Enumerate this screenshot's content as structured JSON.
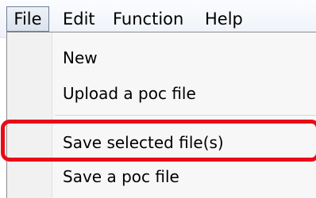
{
  "menubar": {
    "items": [
      {
        "label": "File",
        "active": true
      },
      {
        "label": "Edit",
        "active": false
      },
      {
        "label": "Function",
        "active": false
      },
      {
        "label": "Help",
        "active": false
      }
    ]
  },
  "file_menu": {
    "items": [
      {
        "label": "New"
      },
      {
        "label": "Upload a poc file"
      },
      {
        "label": "Save selected file(s)",
        "highlighted": true
      },
      {
        "label": "Save a poc file"
      }
    ]
  },
  "colors": {
    "highlight": "#e80c16",
    "menu_background": "#f7f7f7",
    "menubar_background": "#eef2f8"
  }
}
